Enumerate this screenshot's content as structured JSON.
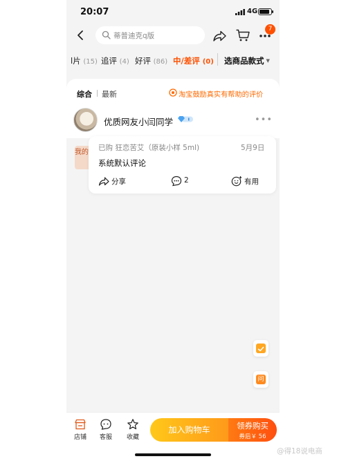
{
  "status_bar": {
    "time": "20:07",
    "network": "4G",
    "battery_level": 0.85
  },
  "header": {
    "search_placeholder": "蒂普迪克q版",
    "cart_badge": "7",
    "icons": [
      "back-icon",
      "search-icon",
      "share-icon",
      "cart-icon",
      "more-icon"
    ]
  },
  "tabs": {
    "items": [
      {
        "label": "l片",
        "count": "(15)"
      },
      {
        "label": "追评",
        "count": "(4)"
      },
      {
        "label": "好评",
        "count": "(86)"
      },
      {
        "label": "中/差评",
        "count": "(0)",
        "active": true
      }
    ],
    "select_label": "选商品款式"
  },
  "sort": {
    "options": [
      "综合",
      "最新"
    ],
    "promo": "淘宝鼓励真实有帮助的评价"
  },
  "review": {
    "username": "优质网友小闫同学",
    "side_label": "我的",
    "purchase": "已购 狂恋苦艾（原装小样 5ml)",
    "date": "5月9日",
    "text": "系统默认评论",
    "share_label": "分享",
    "comment_count": "2",
    "useful_label": "有用"
  },
  "floating": {
    "ask_label": "问"
  },
  "bottom_bar": {
    "store_label": "店铺",
    "service_label": "客服",
    "favorite_label": "收藏",
    "add_cart_label": "加入购物车",
    "buy_label": "领券购买",
    "buy_sub": "券后￥ 56"
  },
  "watermark": "@得18说电商",
  "colors": {
    "accent": "#ff5000",
    "cart_button": "#ffb01a",
    "buy_button": "#ff5a10"
  }
}
